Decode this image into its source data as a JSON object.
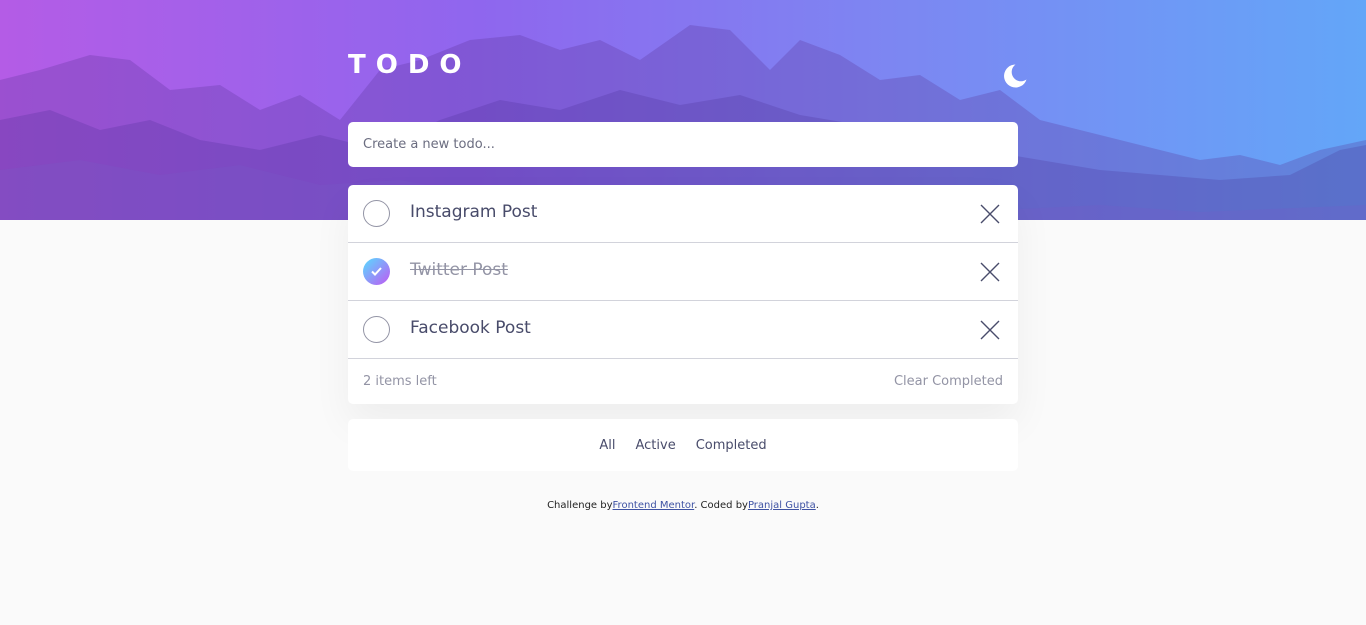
{
  "app": {
    "title": "TODO"
  },
  "theme_toggle": {
    "icon": "moon-icon"
  },
  "new_todo": {
    "placeholder": "Create a new todo..."
  },
  "todos": [
    {
      "text": "Instagram Post",
      "completed": false
    },
    {
      "text": "Twitter Post",
      "completed": true
    },
    {
      "text": "Facebook Post",
      "completed": false
    }
  ],
  "list_footer": {
    "items_left": "2 items left",
    "clear_completed": "Clear Completed"
  },
  "filters": {
    "all": "All",
    "active": "Active",
    "completed": "Completed"
  },
  "attribution": {
    "prefix": "Challenge by",
    "link1": "Frontend Mentor",
    "middle": ". Coded by",
    "link2": "Pranjal Gupta",
    "suffix": "."
  },
  "colors": {
    "gradient_start": "#57ddff",
    "gradient_end": "#c058f3",
    "hero_left": "#b45ce6",
    "hero_right": "#63a6f8"
  }
}
